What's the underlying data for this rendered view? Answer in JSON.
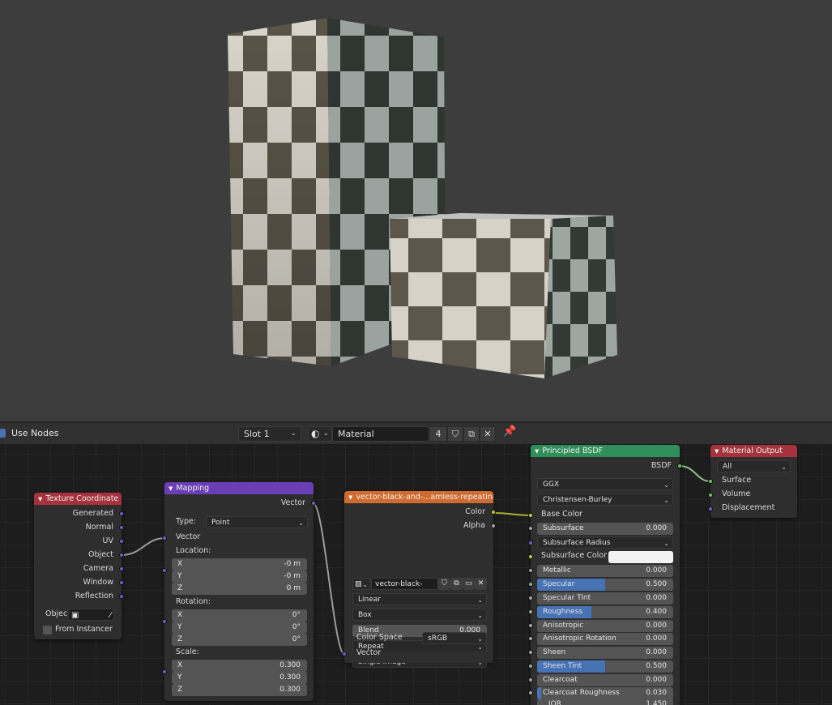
{
  "header": {
    "use_nodes_label": "Use Nodes",
    "slot": "Slot 1",
    "material_name": "Material",
    "users_count": "4"
  },
  "nodes": {
    "texcoord": {
      "title": "Texture Coordinate",
      "outputs": [
        "Generated",
        "Normal",
        "UV",
        "Object",
        "Camera",
        "Window",
        "Reflection"
      ],
      "object_label": "Objec",
      "from_instancer": "From Instancer"
    },
    "mapping": {
      "title": "Mapping",
      "output": "Vector",
      "type_label": "Type:",
      "type_value": "Point",
      "vector_label": "Vector",
      "location_label": "Location:",
      "location": [
        {
          "axis": "X",
          "value": "-0 m"
        },
        {
          "axis": "Y",
          "value": "-0 m"
        },
        {
          "axis": "Z",
          "value": "0 m"
        }
      ],
      "rotation_label": "Rotation:",
      "rotation": [
        {
          "axis": "X",
          "value": "0°"
        },
        {
          "axis": "Y",
          "value": "0°"
        },
        {
          "axis": "Z",
          "value": "0°"
        }
      ],
      "scale_label": "Scale:",
      "scale": [
        {
          "axis": "X",
          "value": "0.300"
        },
        {
          "axis": "Y",
          "value": "0.300"
        },
        {
          "axis": "Z",
          "value": "0.300"
        }
      ]
    },
    "image": {
      "title": "vector-black-and-...amless-repeating-p",
      "out_color": "Color",
      "out_alpha": "Alpha",
      "image_name": "vector-black-and..",
      "interpolation": "Linear",
      "projection": "Box",
      "blend_label": "Blend",
      "blend_value": "0.000",
      "extension": "Repeat",
      "source": "Single Image",
      "colorspace_label": "Color Space",
      "colorspace_value": "sRGB",
      "in_vector": "Vector"
    },
    "bsdf": {
      "title": "Principled BSDF",
      "output": "BSDF",
      "distribution": "GGX",
      "subsurface_method": "Christensen-Burley",
      "base_color": "Base Color",
      "subsurface_radius": "Subsurface Radius",
      "subsurface_color": "Subsurface Color",
      "ior_label": "IOR",
      "ior_value": "1.450",
      "fields": [
        {
          "label": "Subsurface",
          "value": "0.000",
          "fill": 0
        },
        {
          "label": "Metallic",
          "value": "0.000",
          "fill": 0
        },
        {
          "label": "Specular",
          "value": "0.500",
          "fill": 0.5
        },
        {
          "label": "Specular Tint",
          "value": "0.000",
          "fill": 0
        },
        {
          "label": "Roughness",
          "value": "0.400",
          "fill": 0.4
        },
        {
          "label": "Anisotropic",
          "value": "0.000",
          "fill": 0
        },
        {
          "label": "Anisotropic Rotation",
          "value": "0.000",
          "fill": 0
        },
        {
          "label": "Sheen",
          "value": "0.000",
          "fill": 0
        },
        {
          "label": "Sheen Tint",
          "value": "0.500",
          "fill": 0.5
        },
        {
          "label": "Clearcoat",
          "value": "0.000",
          "fill": 0
        },
        {
          "label": "Clearcoat Roughness",
          "value": "0.030",
          "fill": 0.03
        }
      ]
    },
    "output": {
      "title": "Material Output",
      "target": "All",
      "inputs": [
        "Surface",
        "Volume",
        "Displacement"
      ]
    }
  },
  "colors": {
    "input_header": "#a5323d",
    "vector_header": "#6a3fb5",
    "texture_header": "#d06a2e",
    "shader_header": "#2f8f5a",
    "output_header": "#a5323d",
    "accent": "#4772b3"
  }
}
